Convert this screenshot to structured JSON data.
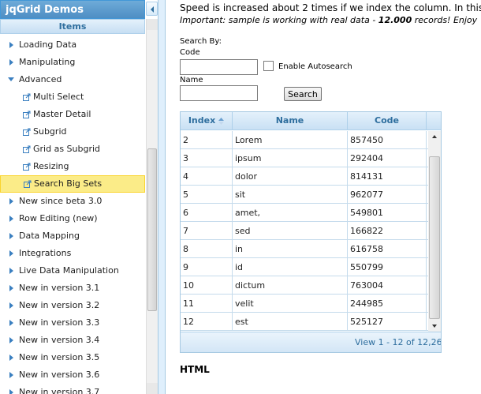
{
  "nav": {
    "title": "jqGrid Demos",
    "items_header": "Items",
    "items": [
      {
        "label": "Loading Data",
        "type": "folder",
        "expanded": false
      },
      {
        "label": "Manipulating",
        "type": "folder",
        "expanded": false
      },
      {
        "label": "Advanced",
        "type": "folder",
        "expanded": true
      },
      {
        "label": "Multi Select",
        "type": "leaf"
      },
      {
        "label": "Master Detail",
        "type": "leaf"
      },
      {
        "label": "Subgrid",
        "type": "leaf"
      },
      {
        "label": "Grid as Subgrid",
        "type": "leaf"
      },
      {
        "label": "Resizing",
        "type": "leaf"
      },
      {
        "label": "Search Big Sets",
        "type": "leaf",
        "selected": true
      },
      {
        "label": "New since beta 3.0",
        "type": "folder",
        "expanded": false
      },
      {
        "label": "Row Editing (new)",
        "type": "folder",
        "expanded": false
      },
      {
        "label": "Data Mapping",
        "type": "folder",
        "expanded": false
      },
      {
        "label": "Integrations",
        "type": "folder",
        "expanded": false
      },
      {
        "label": "Live Data Manipulation",
        "type": "folder",
        "expanded": false
      },
      {
        "label": "New in version 3.1",
        "type": "folder",
        "expanded": false
      },
      {
        "label": "New in version 3.2",
        "type": "folder",
        "expanded": false
      },
      {
        "label": "New in version 3.3",
        "type": "folder",
        "expanded": false
      },
      {
        "label": "New in version 3.4",
        "type": "folder",
        "expanded": false
      },
      {
        "label": "New in version 3.5",
        "type": "folder",
        "expanded": false
      },
      {
        "label": "New in version 3.6",
        "type": "folder",
        "expanded": false
      },
      {
        "label": "New in version 3.7",
        "type": "folder",
        "expanded": false
      }
    ]
  },
  "intro": {
    "line1": "Speed is increased about 2 times if we index the column. In this",
    "line2_prefix": "Important: sample is working with real data - ",
    "line2_bold": "12.000",
    "line2_suffix": " records! Enjoy"
  },
  "search": {
    "search_by_label": "Search By:",
    "code_label": "Code",
    "code_value": "",
    "autosearch_label": "Enable Autosearch",
    "autosearch_checked": false,
    "name_label": "Name",
    "name_value": "",
    "button_label": "Search"
  },
  "grid": {
    "columns": [
      "Index",
      "Name",
      "Code"
    ],
    "sort_column": "Index",
    "rows": [
      [
        "2",
        "Lorem",
        "857450"
      ],
      [
        "3",
        "ipsum",
        "292404"
      ],
      [
        "4",
        "dolor",
        "814131"
      ],
      [
        "5",
        "sit",
        "962077"
      ],
      [
        "6",
        "amet,",
        "549801"
      ],
      [
        "7",
        "sed",
        "166822"
      ],
      [
        "8",
        "in",
        "616758"
      ],
      [
        "9",
        "id",
        "550799"
      ],
      [
        "10",
        "dictum",
        "763004"
      ],
      [
        "11",
        "velit",
        "244985"
      ],
      [
        "12",
        "est",
        "525127"
      ]
    ],
    "pager_text": "View 1 - 12 of 12,26"
  },
  "footer": {
    "html_heading": "HTML"
  },
  "colors": {
    "header_blue": "#5c9ccc",
    "grid_header_text": "#2e6e9e",
    "selected_item": "#fbec88"
  }
}
